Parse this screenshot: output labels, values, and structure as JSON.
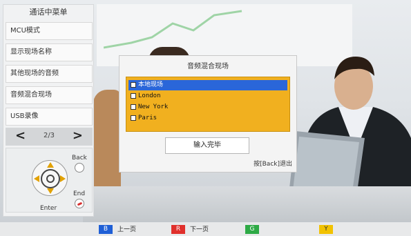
{
  "menu": {
    "title": "通话中菜单",
    "items": [
      {
        "label": "MCU模式"
      },
      {
        "label": "显示现场名称"
      },
      {
        "label": "其他现场的音频"
      },
      {
        "label": "音频混合现场"
      },
      {
        "label": "USB录像"
      }
    ],
    "pager": {
      "prev": "<",
      "next": ">",
      "page": "2/3"
    }
  },
  "remote": {
    "back_label": "Back",
    "end_label": "End",
    "enter_label": "Enter"
  },
  "dialog": {
    "title": "音频混合现场",
    "options": [
      {
        "label": "本地现场",
        "selected": true
      },
      {
        "label": "London",
        "selected": false
      },
      {
        "label": "New York",
        "selected": false
      },
      {
        "label": "Paris",
        "selected": false
      }
    ],
    "done_button": "输入完毕",
    "exit_hint": "按[Back]退出"
  },
  "bottom_bar": {
    "buttons": [
      {
        "key": "B",
        "label": "上一页",
        "color": "#1f5fd6"
      },
      {
        "key": "R",
        "label": "下一页",
        "color": "#e0302c"
      },
      {
        "key": "G",
        "label": "",
        "color": "#2eaa46"
      },
      {
        "key": "Y",
        "label": "",
        "color": "#f2c200"
      }
    ]
  }
}
